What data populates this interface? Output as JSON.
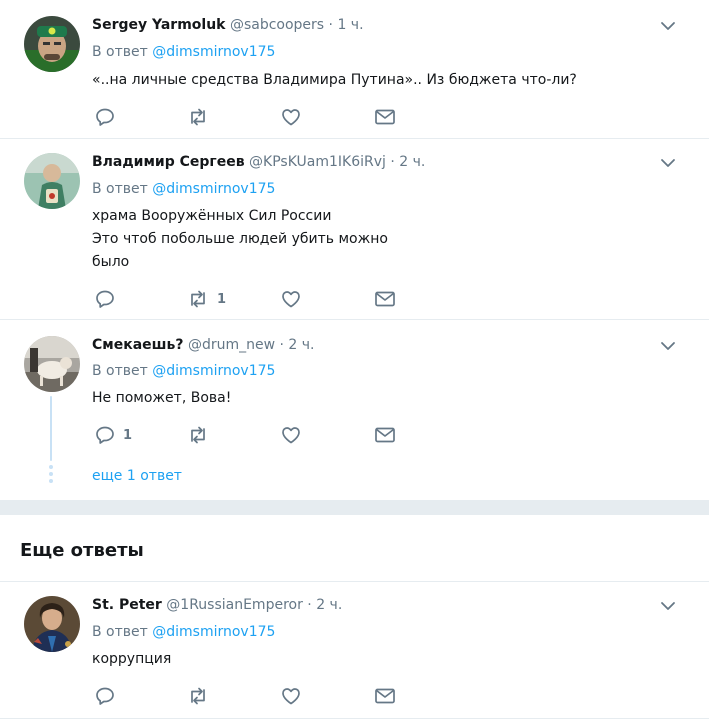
{
  "tweets": [
    {
      "name": "Sergey Yarmoluk",
      "handle": "@sabcoopers",
      "sep": "·",
      "time": "1 ч.",
      "reply_prefix": "В ответ",
      "reply_mention": "@dimsmirnov175",
      "text_lines": [
        "«..на личные средства Владимира Путина».. Из бюджета что-ли?"
      ],
      "reply_count": "",
      "retweet_count": "",
      "like_count": ""
    },
    {
      "name": "Владимир Сергеев",
      "handle": "@KPsKUam1IK6iRvj",
      "sep": "·",
      "time": "2 ч.",
      "reply_prefix": "В ответ",
      "reply_mention": "@dimsmirnov175",
      "text_lines": [
        "храма Вооружённых Сил России",
        "Это чтоб побольше людей убить можно",
        "было"
      ],
      "reply_count": "",
      "retweet_count": "1",
      "like_count": ""
    },
    {
      "name": "Смекаешь?",
      "handle": "@drum_new",
      "sep": "·",
      "time": "2 ч.",
      "reply_prefix": "В ответ",
      "reply_mention": "@dimsmirnov175",
      "text_lines": [
        "Не поможет, Вова!"
      ],
      "reply_count": "1",
      "retweet_count": "",
      "like_count": "",
      "more_replies": "еще 1 ответ"
    }
  ],
  "section_title": "Еще ответы",
  "more_tweets": [
    {
      "name": "St. Peter",
      "handle": "@1RussianEmperor",
      "sep": "·",
      "time": "2 ч.",
      "reply_prefix": "В ответ",
      "reply_mention": "@dimsmirnov175",
      "text_lines": [
        "коррупция"
      ],
      "reply_count": "",
      "retweet_count": "",
      "like_count": ""
    }
  ],
  "icons": {
    "reply": "reply-icon",
    "retweet": "retweet-icon",
    "like": "heart-icon",
    "dm": "envelope-icon",
    "menu": "chevron-down-icon"
  },
  "colors": {
    "text": "#14171a",
    "secondary": "#657786",
    "link": "#1da1f2",
    "border": "#e6ecf0",
    "thread": "#c8e1f5"
  }
}
